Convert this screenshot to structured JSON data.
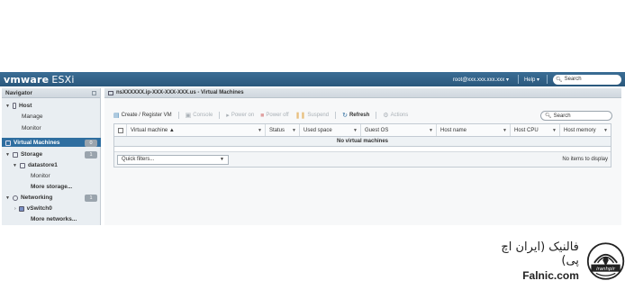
{
  "topbar": {
    "brand": "vmware",
    "product": "ESXi",
    "user": "root@xxx.xxx.xxx.xxx ▾",
    "help": "Help ▾",
    "search_placeholder": "Search"
  },
  "navigator": {
    "title": "Navigator",
    "items": [
      {
        "label": "Host"
      },
      {
        "label": "Manage"
      },
      {
        "label": "Monitor"
      },
      {
        "label": "Virtual Machines",
        "badge": "0"
      },
      {
        "label": "Storage",
        "badge": "1"
      },
      {
        "label": "datastore1"
      },
      {
        "label": "Monitor"
      },
      {
        "label": "More storage..."
      },
      {
        "label": "Networking",
        "badge": "1"
      },
      {
        "label": "vSwitch0"
      },
      {
        "label": "More networks..."
      }
    ]
  },
  "main": {
    "title": "nsXXXXXX.ip-XXX-XXX-XXX.us - Virtual Machines",
    "toolbar": {
      "create": "Create / Register VM",
      "console": "Console",
      "power_on": "Power on",
      "power_off": "Power off",
      "suspend": "Suspend",
      "refresh": "Refresh",
      "actions": "Actions"
    },
    "search_placeholder": "Search",
    "columns": [
      "Virtual machine ▲",
      "Status",
      "Used space",
      "Guest OS",
      "Host name",
      "Host CPU",
      "Host memory"
    ],
    "empty_text": "No virtual machines",
    "quick_filters": "Quick filters...",
    "no_items": "No items to display"
  },
  "watermark": {
    "persian": "فالنیک (ایران اچ پی)",
    "english": "Falnic.com",
    "mark_text": "ایران اچ پی"
  },
  "colors": {
    "topbar": "#2f5f86",
    "selected": "#2f6ea0",
    "badge": "#9aa4ad"
  }
}
